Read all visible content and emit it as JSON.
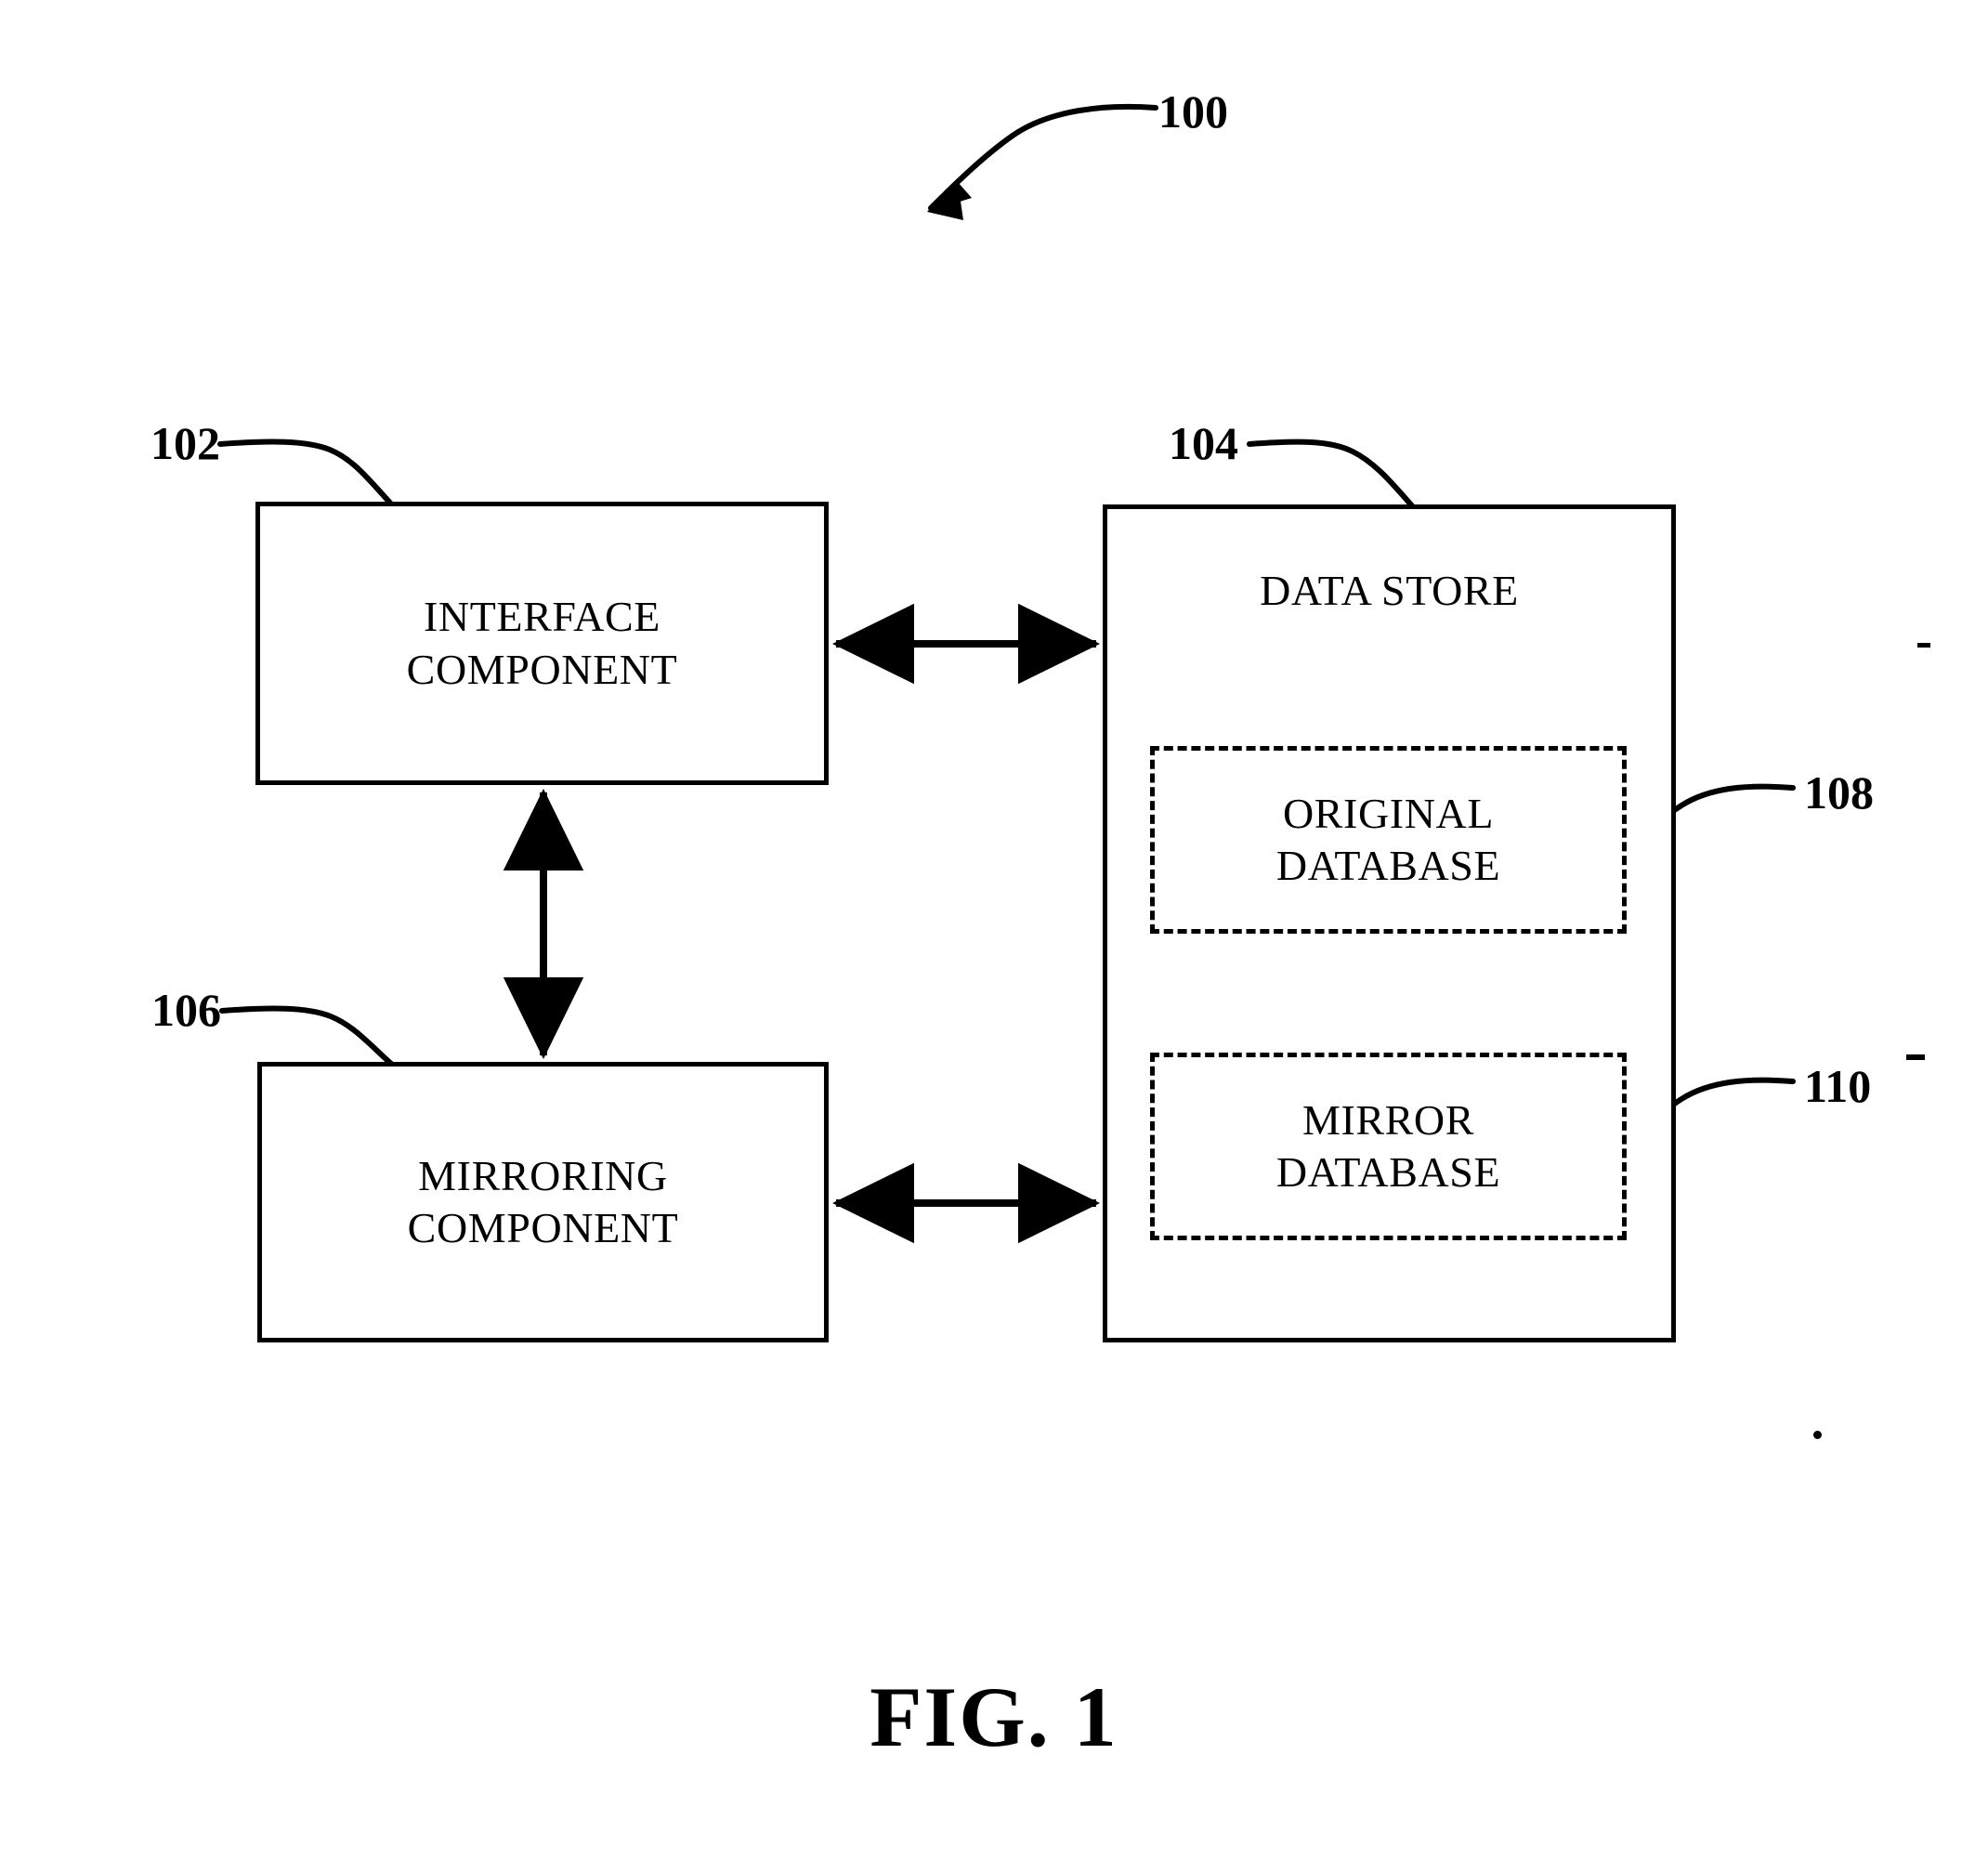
{
  "figure": {
    "caption": "FIG. 1",
    "system_ref": "100"
  },
  "nodes": [
    {
      "id": "interface-component",
      "ref": "102",
      "label": "INTERFACE\nCOMPONENT",
      "style": "solid"
    },
    {
      "id": "data-store",
      "ref": "104",
      "label": "DATA STORE",
      "style": "solid"
    },
    {
      "id": "mirroring-component",
      "ref": "106",
      "label": "MIRRORING\nCOMPONENT",
      "style": "solid"
    },
    {
      "id": "original-database",
      "ref": "108",
      "label": "ORIGINAL\nDATABASE",
      "style": "dashed"
    },
    {
      "id": "mirror-database",
      "ref": "110",
      "label": "MIRROR\nDATABASE",
      "style": "dashed"
    }
  ],
  "connectors": [
    {
      "id": "interface-to-data-store",
      "from": "interface-component",
      "to": "data-store",
      "arrow": "double",
      "orientation": "horizontal"
    },
    {
      "id": "interface-to-mirroring",
      "from": "interface-component",
      "to": "mirroring-component",
      "arrow": "double",
      "orientation": "vertical"
    },
    {
      "id": "mirroring-to-data-store",
      "from": "mirroring-component",
      "to": "data-store",
      "arrow": "double",
      "orientation": "horizontal"
    }
  ],
  "colors": {
    "ink": "#000000",
    "paper": "#ffffff"
  }
}
